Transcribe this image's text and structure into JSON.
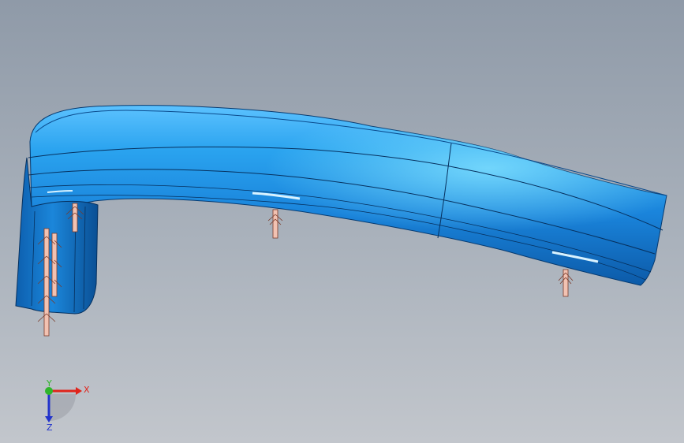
{
  "viewport": {
    "axes": {
      "x_label": "X",
      "y_label": "Y",
      "z_label": "Z"
    },
    "colors": {
      "part": "#1e88e0",
      "part_highlight": "#6fd0ff",
      "part_shadow": "#0b4f96",
      "ejector": "#f2c2b2",
      "x_axis": "#e0241b",
      "y_axis": "#2fb52a",
      "z_axis": "#2233cc"
    }
  }
}
